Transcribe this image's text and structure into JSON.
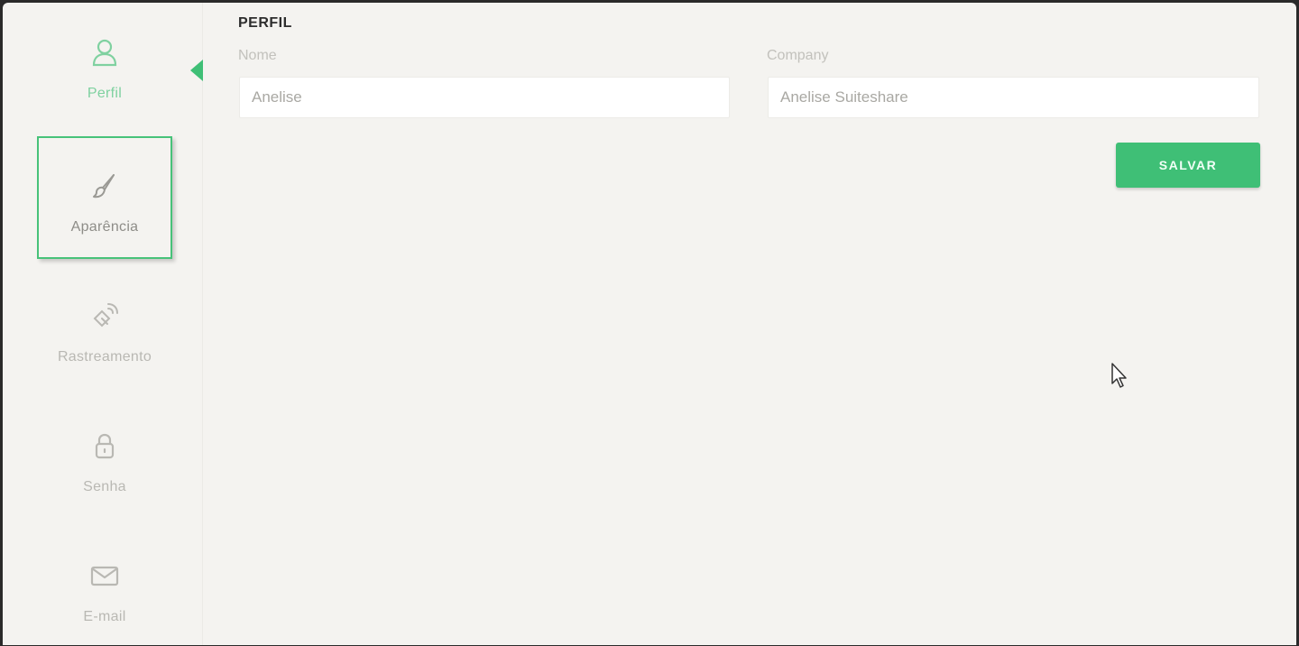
{
  "sidebar": {
    "items": [
      {
        "label": "Perfil",
        "icon": "user-icon"
      },
      {
        "label": "Aparência",
        "icon": "brush-icon"
      },
      {
        "label": "Rastreamento",
        "icon": "satellite-icon"
      },
      {
        "label": "Senha",
        "icon": "lock-icon"
      },
      {
        "label": "E-mail",
        "icon": "mail-icon"
      }
    ],
    "active_index": 0,
    "hovered_index": 1
  },
  "main": {
    "section_title": "PERFIL",
    "fields": {
      "name": {
        "label": "Nome",
        "value": "Anelise"
      },
      "company": {
        "label": "Company",
        "value": "Anelise Suiteshare"
      }
    },
    "save_label": "SALVAR"
  },
  "colors": {
    "accent": "#3fbf76",
    "background": "#f4f3f0",
    "muted_text": "#b9b8b3"
  }
}
